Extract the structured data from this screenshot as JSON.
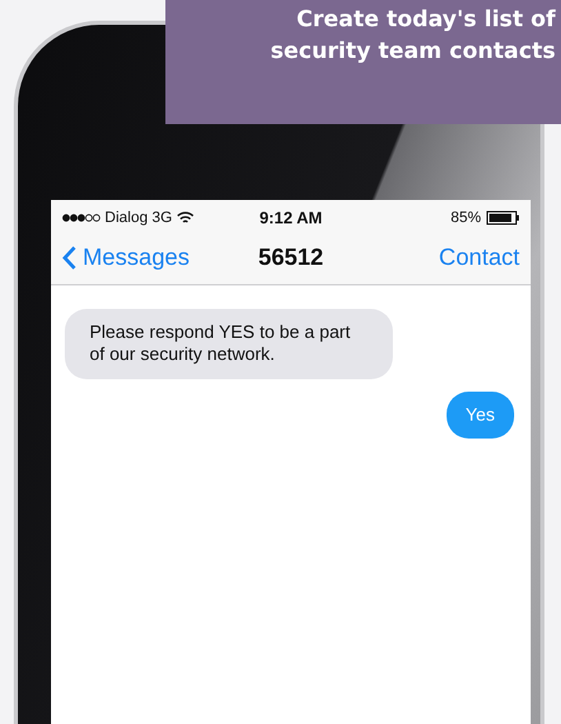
{
  "banner": {
    "lines": [
      "Create today's list of",
      "security team contacts"
    ]
  },
  "status_bar": {
    "carrier": "Dialog 3G",
    "time": "9:12 AM",
    "battery": "85%"
  },
  "nav_bar": {
    "back": "Messages",
    "title": "56512",
    "action": "Contact"
  },
  "messages": [
    {
      "kind": "incoming",
      "text": "Please respond YES to be a part of our security network."
    },
    {
      "kind": "outgoing",
      "text": "Yes"
    }
  ]
}
